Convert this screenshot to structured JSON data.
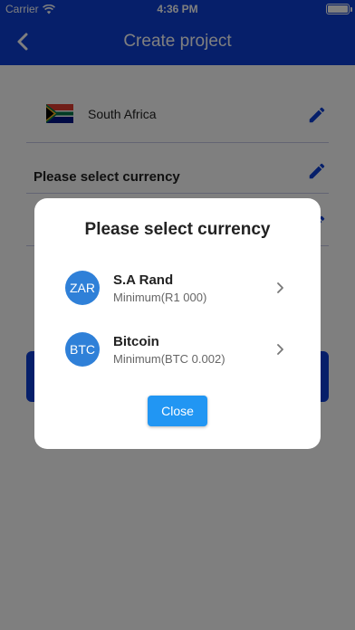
{
  "status_bar": {
    "carrier": "Carrier",
    "time": "4:36 PM",
    "battery_level": 1.0
  },
  "header": {
    "title": "Create project",
    "back_icon": "chevron-left-icon"
  },
  "form": {
    "country": {
      "name": "South Africa",
      "flag_icon": "south-africa-flag-icon",
      "edit_icon": "pencil-icon"
    },
    "currency": {
      "prompt": "Please select currency",
      "edit_icon": "pencil-icon"
    }
  },
  "dialog": {
    "title": "Please select currency",
    "options": [
      {
        "badge": "ZAR",
        "name": "S.A Rand",
        "minimum": "Minimum(R1 000)"
      },
      {
        "badge": "BTC",
        "name": "Bitcoin",
        "minimum": "Minimum(BTC 0.002)"
      }
    ],
    "close_label": "Close"
  },
  "colors": {
    "primary": "#0d3ed4",
    "badge": "#2f80d8",
    "close_button": "#2196f3"
  }
}
